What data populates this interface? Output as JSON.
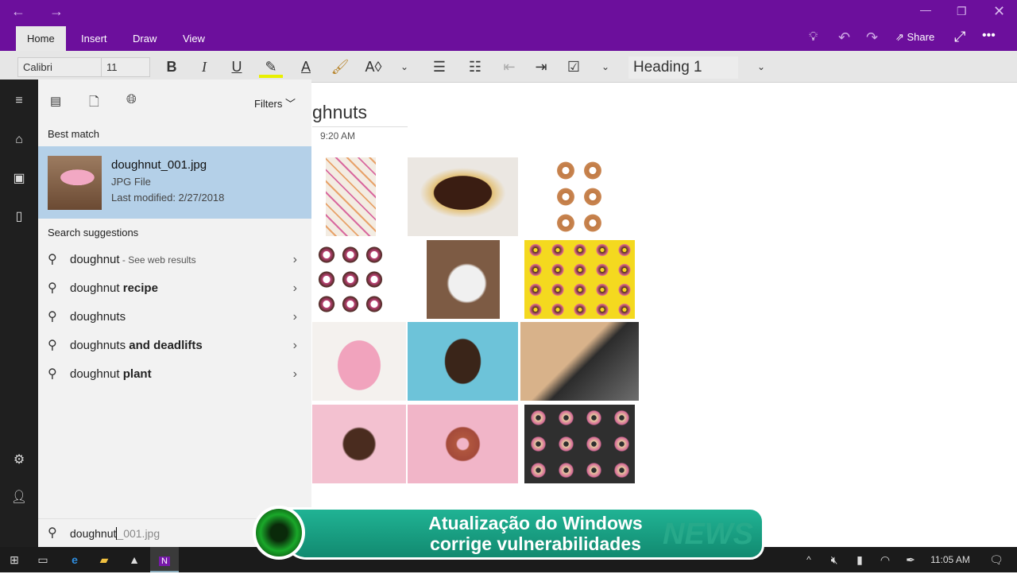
{
  "titlebar": {
    "tabs": [
      "Home",
      "Insert",
      "Draw",
      "View"
    ],
    "share": "Share"
  },
  "toolbar": {
    "font": "Calibri",
    "size": "11",
    "bold": "B",
    "italic": "I",
    "underline": "U",
    "style": "Heading 1"
  },
  "search": {
    "filters": "Filters",
    "best_match_label": "Best match",
    "best": {
      "name": "doughnut_001.jpg",
      "type": "JPG File",
      "modified": "Last modified: 2/27/2018"
    },
    "suggestions_label": "Search suggestions",
    "suggestions": [
      {
        "a": "doughnut",
        "b": " - See web results"
      },
      {
        "a": "doughnut ",
        "b": "recipe"
      },
      {
        "a": "doughnuts",
        "b": ""
      },
      {
        "a": "doughnuts ",
        "b": "and deadlifts"
      },
      {
        "a": "doughnut ",
        "b": "plant"
      }
    ],
    "query": "doughnut",
    "completion": "_001.jpg"
  },
  "page": {
    "title": "ghnuts",
    "time": "9:20 AM"
  },
  "banner": {
    "line1": "Atualização do Windows",
    "line2": "corrige vulnerabilidades",
    "news": "NEWS"
  },
  "taskbar": {
    "clock": "11:05 AM"
  }
}
